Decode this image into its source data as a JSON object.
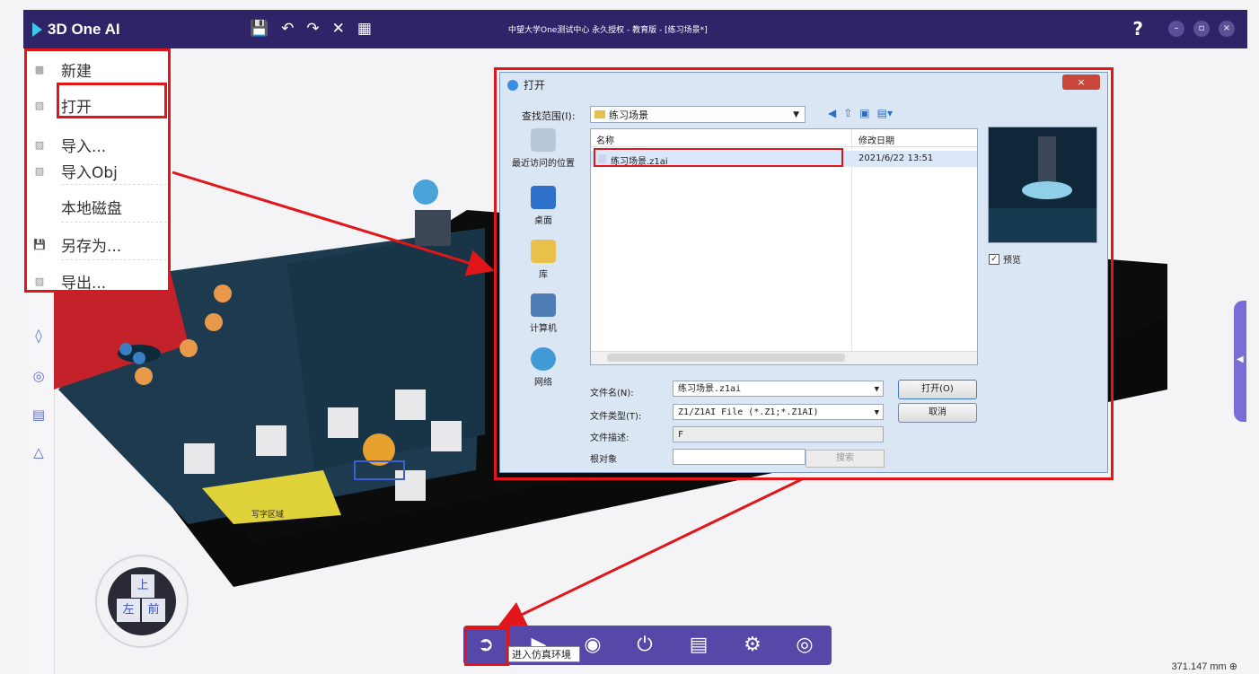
{
  "app": {
    "name": "3D One AI",
    "window_title": "中望大学One测试中心 永久授权 - 教育版 - [练习场景*]",
    "help_label": "?",
    "window_buttons": [
      "–",
      "▫",
      "×"
    ],
    "toolbar_icons": [
      "save-icon",
      "undo-icon",
      "redo-icon",
      "close-icon",
      "grid-icon"
    ]
  },
  "file_menu": {
    "items": [
      {
        "label": "新建",
        "icon": "new-file-icon"
      },
      {
        "label": "打开",
        "icon": "open-folder-icon"
      },
      {
        "label": "导入...",
        "icon": "import-icon"
      },
      {
        "label": "导入Obj",
        "icon": "import-obj-icon"
      },
      {
        "label": "本地磁盘",
        "icon": ""
      },
      {
        "label": "另存为...",
        "icon": "save-as-icon"
      },
      {
        "label": "导出...",
        "icon": "export-icon"
      }
    ]
  },
  "dialog": {
    "title": "打开",
    "close_label": "×",
    "lookin_label": "查找范围(I):",
    "lookin_value": "练习场景",
    "places": [
      "最近访问的位置",
      "桌面",
      "库",
      "计算机",
      "网络"
    ],
    "columns": {
      "name": "名称",
      "date": "修改日期"
    },
    "files": [
      {
        "name": "练习场景.z1ai",
        "date": "2021/6/22 13:51"
      }
    ],
    "preview_checkbox": "预览",
    "filename_label": "文件名(N):",
    "filename_value": "练习场景.z1ai",
    "filetype_label": "文件类型(T):",
    "filetype_value": "Z1/Z1AI File (*.Z1;*.Z1AI)",
    "filedesc_label": "文件描述:",
    "filedesc_value": "F",
    "root_label": "根对象",
    "search_label": "搜索",
    "open_button": "打开(O)",
    "cancel_button": "取消"
  },
  "bottom_toolbar": {
    "buttons": [
      "enter-sim-icon",
      "play-icon",
      "record-icon",
      "power-icon",
      "notes-icon",
      "settings-icon",
      "view-icon"
    ],
    "tooltip": "进入仿真环境"
  },
  "view_cube": {
    "top": "上",
    "front": "前",
    "left": "左"
  },
  "status": {
    "scale": "371.147 mm"
  },
  "scene": {
    "sign_text": "写字区域"
  },
  "colors": {
    "titlebar": "#2f2468",
    "accent": "#5548a8",
    "highlight": "#e0161a"
  }
}
